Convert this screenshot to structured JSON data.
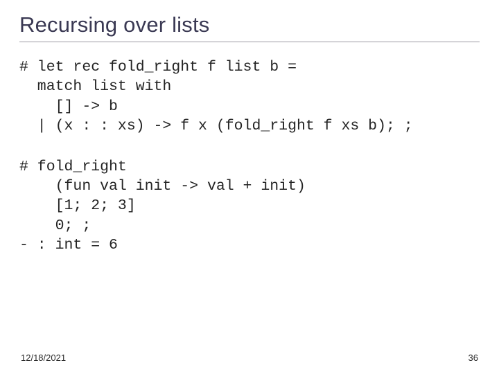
{
  "title": "Recursing over lists",
  "code_block_1": "# let rec fold_right f list b =\n  match list with\n    [] -> b\n  | (x : : xs) -> f x (fold_right f xs b); ;",
  "code_block_2": "# fold_right\n    (fun val init -> val + init)\n    [1; 2; 3]\n    0; ;\n- : int = 6",
  "footer_date": "12/18/2021",
  "footer_page": "36"
}
